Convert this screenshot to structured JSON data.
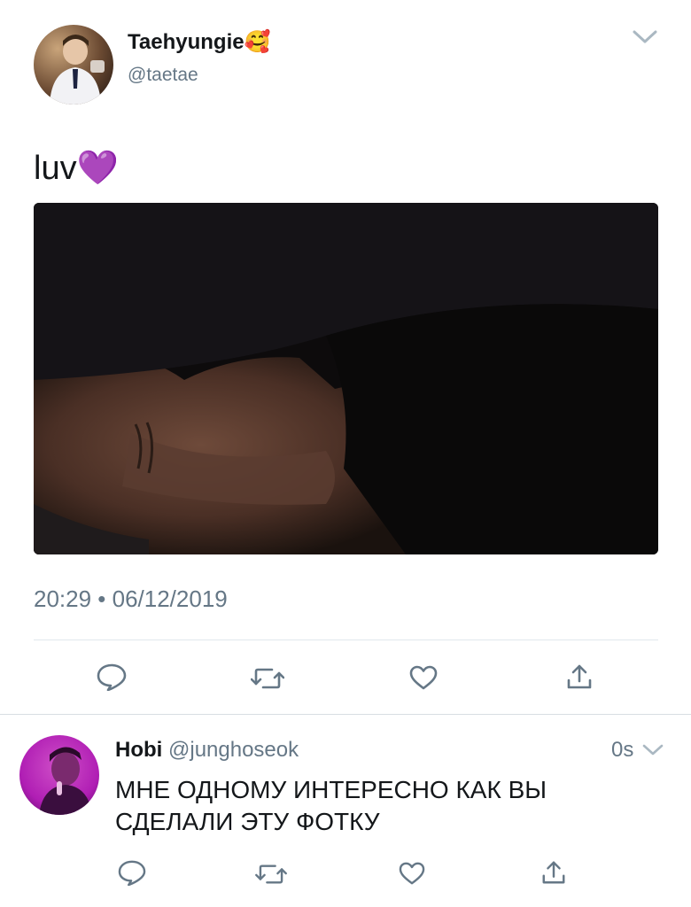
{
  "tweet": {
    "author_name": "Taehyungie",
    "author_emoji": "🥰",
    "author_handle": "@taetae",
    "text": "luv",
    "text_emoji": "💜",
    "timestamp": "20:29 • 06/12/2019"
  },
  "reply": {
    "author_name": "Hobi",
    "author_handle": "@junghoseok",
    "time": "0s",
    "text_line1": "МНЕ ОДНОМУ ИНТЕРЕСНО КАК ВЫ",
    "text_line2": "СДЕЛАЛИ ЭТУ ФОТКУ"
  },
  "icons": {
    "chevron": "chevron-down-icon",
    "reply": "reply-icon",
    "retweet": "retweet-icon",
    "like": "heart-icon",
    "share": "share-icon"
  },
  "colors": {
    "text": "#14171a",
    "secondary": "#657786",
    "divider": "#e1e8ed",
    "action_icon": "#657786",
    "chevron": "#aab8c2"
  }
}
